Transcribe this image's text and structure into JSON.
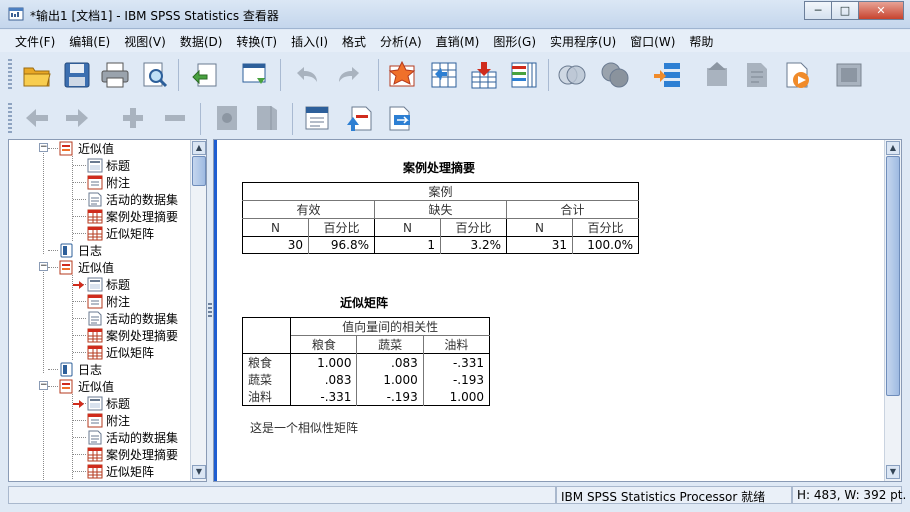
{
  "window": {
    "title": "*输出1 [文档1] - IBM SPSS Statistics 查看器",
    "minimize": "─",
    "maximize": "□",
    "close": "✕"
  },
  "menu": [
    "文件(F)",
    "编辑(E)",
    "视图(V)",
    "数据(D)",
    "转换(T)",
    "插入(I)",
    "格式",
    "分析(A)",
    "直销(M)",
    "图形(G)",
    "实用程序(U)",
    "窗口(W)",
    "帮助"
  ],
  "outline": {
    "nodes": [
      {
        "label": "近似值",
        "type": "proc",
        "level": 1,
        "expanded": true
      },
      {
        "label": "标题",
        "type": "title",
        "level": 2
      },
      {
        "label": "附注",
        "type": "notes",
        "level": 2
      },
      {
        "label": "活动的数据集",
        "type": "dataset",
        "level": 2
      },
      {
        "label": "案例处理摘要",
        "type": "table",
        "level": 2
      },
      {
        "label": "近似矩阵",
        "type": "table",
        "level": 2
      },
      {
        "label": "日志",
        "type": "log",
        "level": 1
      },
      {
        "label": "近似值",
        "type": "proc",
        "level": 1,
        "expanded": true
      },
      {
        "label": "标题",
        "type": "title",
        "level": 2,
        "current": true
      },
      {
        "label": "附注",
        "type": "notes",
        "level": 2
      },
      {
        "label": "活动的数据集",
        "type": "dataset",
        "level": 2
      },
      {
        "label": "案例处理摘要",
        "type": "table",
        "level": 2
      },
      {
        "label": "近似矩阵",
        "type": "table",
        "level": 2
      },
      {
        "label": "日志",
        "type": "log",
        "level": 1
      },
      {
        "label": "近似值",
        "type": "proc",
        "level": 1,
        "expanded": true
      },
      {
        "label": "标题",
        "type": "title",
        "level": 2,
        "current": true
      },
      {
        "label": "附注",
        "type": "notes",
        "level": 2
      },
      {
        "label": "活动的数据集",
        "type": "dataset",
        "level": 2
      },
      {
        "label": "案例处理摘要",
        "type": "table",
        "level": 2
      },
      {
        "label": "近似矩阵",
        "type": "table",
        "level": 2
      }
    ]
  },
  "case_summary": {
    "title": "案例处理摘要",
    "group_header": "案例",
    "groups": [
      "有效",
      "缺失",
      "合计"
    ],
    "sub_headers": [
      "N",
      "百分比",
      "N",
      "百分比",
      "N",
      "百分比"
    ],
    "values": [
      "30",
      "96.8%",
      "1",
      "3.2%",
      "31",
      "100.0%"
    ]
  },
  "proximity_matrix": {
    "title": "近似矩阵",
    "header": "值向量间的相关性",
    "columns": [
      "粮食",
      "蔬菜",
      "油料"
    ],
    "rows": [
      {
        "label": "粮食",
        "values": [
          "1.000",
          ".083",
          "-.331"
        ]
      },
      {
        "label": "蔬菜",
        "values": [
          ".083",
          "1.000",
          "-.193"
        ]
      },
      {
        "label": "油料",
        "values": [
          "-.331",
          "-.193",
          "1.000"
        ]
      }
    ],
    "footnote": "这是一个相似性矩阵"
  },
  "status": {
    "processor": "IBM SPSS Statistics Processor 就绪",
    "dimensions": "H: 483, W: 392 pt."
  }
}
